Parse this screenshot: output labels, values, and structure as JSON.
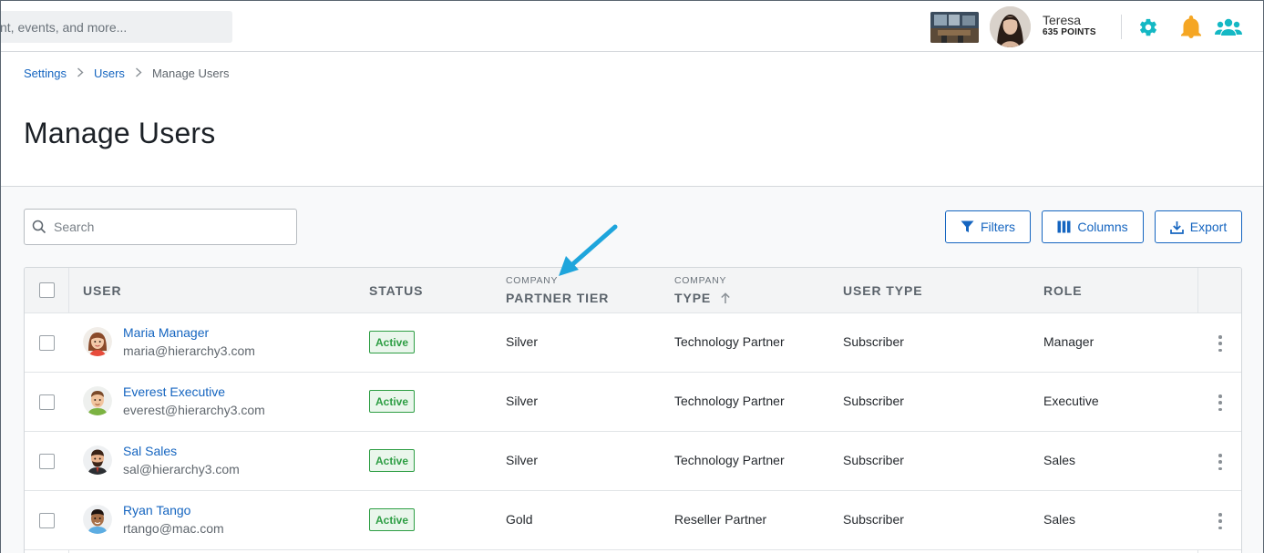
{
  "header": {
    "search_text": "nt, events, and more...",
    "user_name": "Teresa",
    "user_points": "635 POINTS",
    "icons": [
      "gear-icon",
      "bell-icon",
      "users-icon"
    ],
    "accent_color": "#14b8c4",
    "bell_color": "#f5a623"
  },
  "breadcrumb": {
    "items": [
      "Settings",
      "Users"
    ],
    "current": "Manage Users"
  },
  "page": {
    "title": "Manage Users"
  },
  "toolbar": {
    "search_placeholder": "Search",
    "filters_label": "Filters",
    "columns_label": "Columns",
    "export_label": "Export"
  },
  "table": {
    "headers": {
      "user": "USER",
      "status": "STATUS",
      "partner_tier_pre": "COMPANY",
      "partner_tier": "PARTNER TIER",
      "type_pre": "COMPANY",
      "type": "TYPE",
      "user_type": "USER TYPE",
      "role": "ROLE"
    },
    "sort": {
      "column": "type",
      "direction": "ascending"
    },
    "rows": [
      {
        "name": "Maria Manager",
        "email": "maria@hierarchy3.com",
        "status": "Active",
        "tier": "Silver",
        "company_type": "Technology Partner",
        "user_type": "Subscriber",
        "role": "Manager"
      },
      {
        "name": "Everest Executive",
        "email": "everest@hierarchy3.com",
        "status": "Active",
        "tier": "Silver",
        "company_type": "Technology Partner",
        "user_type": "Subscriber",
        "role": "Executive"
      },
      {
        "name": "Sal Sales",
        "email": "sal@hierarchy3.com",
        "status": "Active",
        "tier": "Silver",
        "company_type": "Technology Partner",
        "user_type": "Subscriber",
        "role": "Sales"
      },
      {
        "name": "Ryan Tango",
        "email": "rtango@mac.com",
        "status": "Active",
        "tier": "Gold",
        "company_type": "Reseller Partner",
        "user_type": "Subscriber",
        "role": "Sales"
      }
    ]
  },
  "status_color": "#2e9e44",
  "link_color": "#1565c0",
  "annotation_arrow_color": "#1ea5dc"
}
